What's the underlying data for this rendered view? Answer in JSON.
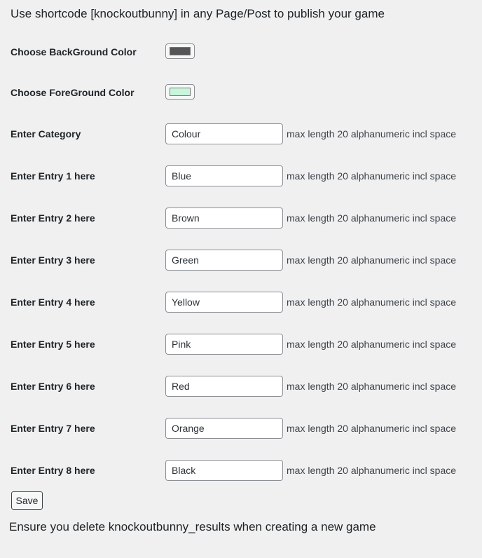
{
  "heading": "Use shortcode [knockoutbunny] in any Page/Post to publish your game",
  "colors": {
    "background_label": "Choose BackGround Color",
    "background_value": "#555555",
    "foreground_label": "Choose ForeGround Color",
    "foreground_value": "#c8f5dc"
  },
  "fields": [
    {
      "label": "Enter Category",
      "value": "Colour",
      "hint": "max length 20 alphanumeric incl space"
    },
    {
      "label": "Enter Entry 1 here",
      "value": "Blue",
      "hint": "max length 20 alphanumeric incl space"
    },
    {
      "label": "Enter Entry 2 here",
      "value": "Brown",
      "hint": "max length 20 alphanumeric incl space"
    },
    {
      "label": "Enter Entry 3 here",
      "value": "Green",
      "hint": "max length 20 alphanumeric incl space"
    },
    {
      "label": "Enter Entry 4 here",
      "value": "Yellow",
      "hint": "max length 20 alphanumeric incl space"
    },
    {
      "label": "Enter Entry 5 here",
      "value": "Pink",
      "hint": "max length 20 alphanumeric incl space"
    },
    {
      "label": "Enter Entry 6 here",
      "value": "Red",
      "hint": "max length 20 alphanumeric incl space"
    },
    {
      "label": "Enter Entry 7 here",
      "value": "Orange",
      "hint": "max length 20 alphanumeric incl space"
    },
    {
      "label": "Enter Entry 8 here",
      "value": "Black",
      "hint": "max length 20 alphanumeric incl space"
    }
  ],
  "save_label": "Save",
  "footer_note": "Ensure you delete knockoutbunny_results when creating a new game"
}
